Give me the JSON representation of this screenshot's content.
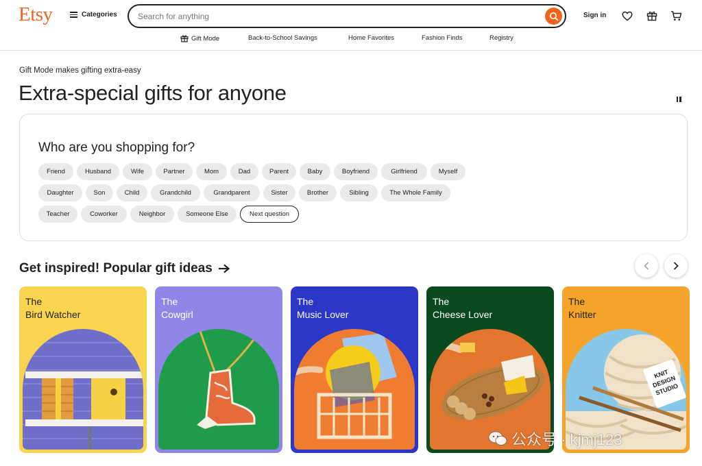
{
  "header": {
    "logo": "Etsy",
    "categories_label": "Categories",
    "search_placeholder": "Search for anything",
    "signin_label": "Sign in"
  },
  "nav": {
    "items": [
      "Gift Mode",
      "Back-to-School Savings",
      "Home Favorites",
      "Fashion Finds",
      "Registry"
    ]
  },
  "hero": {
    "subtitle": "Gift Mode makes gifting extra-easy",
    "title": "Extra-special gifts for anyone"
  },
  "quiz": {
    "title": "Who are you shopping for?",
    "row1": [
      "Friend",
      "Husband",
      "Wife",
      "Partner",
      "Mom",
      "Dad",
      "Parent",
      "Baby",
      "Boyfriend",
      "Girlfriend",
      "Myself"
    ],
    "row2": [
      "Daughter",
      "Son",
      "Child",
      "Grandchild",
      "Grandparent",
      "Sister",
      "Brother",
      "Sibling",
      "The Whole Family"
    ],
    "row3": [
      "Teacher",
      "Coworker",
      "Neighbor",
      "Someone Else"
    ],
    "next_label": "Next question"
  },
  "ideas": {
    "title": "Get inspired! Popular gift ideas",
    "cards": [
      {
        "line1": "The",
        "line2": "Bird Watcher",
        "bg": "#f8d44f",
        "text": "#222222"
      },
      {
        "line1": "The",
        "line2": "Cowgirl",
        "bg": "#8f86e8",
        "text": "#ffffff"
      },
      {
        "line1": "The",
        "line2": "Music Lover",
        "bg": "#2a37c7",
        "text": "#ffffff"
      },
      {
        "line1": "The",
        "line2": "Cheese Lover",
        "bg": "#0b4a1f",
        "text": "#ffffff"
      },
      {
        "line1": "The",
        "line2": "Knitter",
        "bg": "#f4a42b",
        "text": "#222222"
      }
    ]
  },
  "watermark": "公众号 · kjmj123",
  "colors": {
    "brand": "#f1641e",
    "text": "#222222",
    "chip_bg": "#eaeaea"
  }
}
